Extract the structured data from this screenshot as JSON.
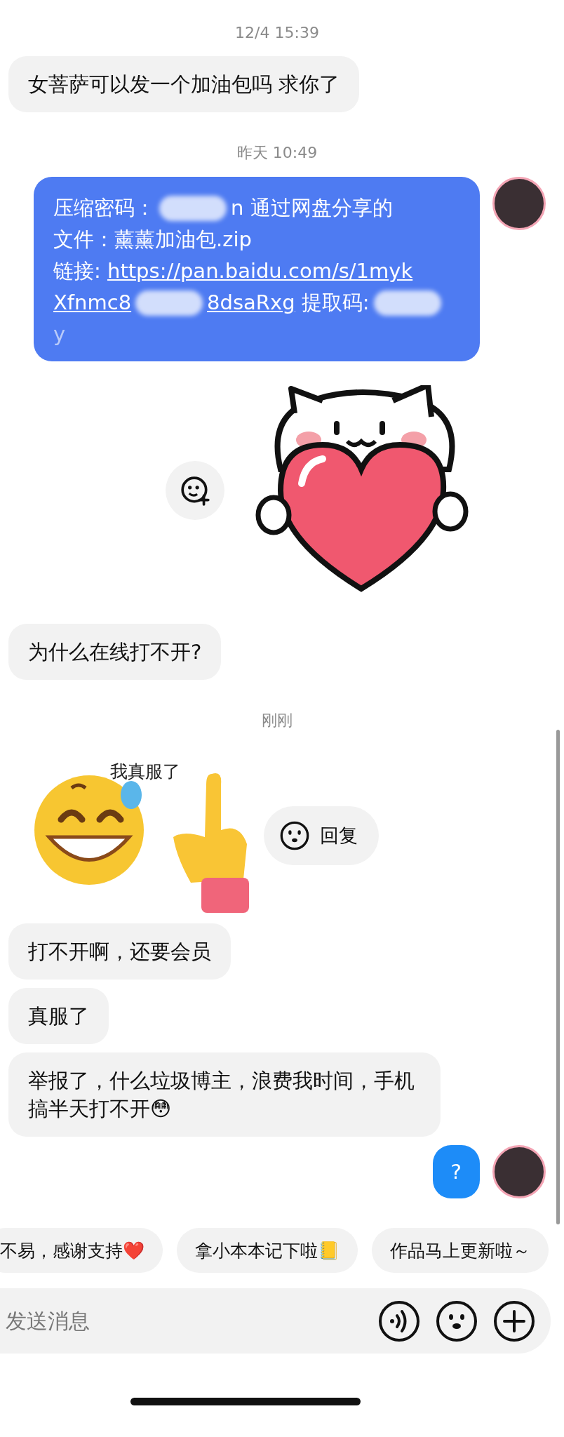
{
  "messages": [
    {
      "kind": "time",
      "text": "12/4 15:39"
    },
    {
      "kind": "text",
      "outgoing": false,
      "text": "女菩萨可以发一个加油包吗 求你了"
    },
    {
      "kind": "time",
      "text": "昨天 10:49"
    },
    {
      "kind": "share",
      "outgoing": true,
      "lines": [
        [
          {
            "kind": "text",
            "text": "压缩密码："
          },
          {
            "kind": "redacted"
          },
          {
            "kind": "text",
            "text": "n 通过网盘分享的"
          }
        ],
        [
          {
            "kind": "text",
            "text": "文件：薰薰加油包.zip"
          }
        ],
        [
          {
            "kind": "text",
            "text": "链接: "
          },
          {
            "kind": "link",
            "text": "https://pan.baidu.com/s/1myk"
          }
        ],
        [
          {
            "kind": "link",
            "text": "Xfnmc8"
          },
          {
            "kind": "redacted"
          },
          {
            "kind": "link",
            "text": "8dsaRxg"
          },
          {
            "kind": "text",
            "text": " 提取码:"
          },
          {
            "kind": "redacted"
          }
        ],
        [
          {
            "kind": "faded",
            "text": "y"
          }
        ]
      ]
    },
    {
      "kind": "sticker",
      "outgoing": true
    },
    {
      "kind": "text",
      "outgoing": false,
      "text": "为什么在线打不开?"
    },
    {
      "kind": "time",
      "text": "刚刚"
    },
    {
      "kind": "meme",
      "outgoing": false,
      "caption": "我真服了",
      "reply": "回复"
    },
    {
      "kind": "text",
      "outgoing": false,
      "text": "打不开啊，还要会员"
    },
    {
      "kind": "text",
      "outgoing": false,
      "text": "真服了"
    },
    {
      "kind": "text",
      "outgoing": false,
      "text": "举报了，什么垃圾博主，浪费我时间，手机搞半天打不开😳"
    },
    {
      "kind": "text",
      "outgoing": true,
      "text": "?"
    }
  ],
  "quick_replies": [
    "不易，感谢支持❤️",
    "拿小本本记下啦📒",
    "作品马上更新啦～"
  ],
  "input": {
    "placeholder": "发送消息"
  }
}
